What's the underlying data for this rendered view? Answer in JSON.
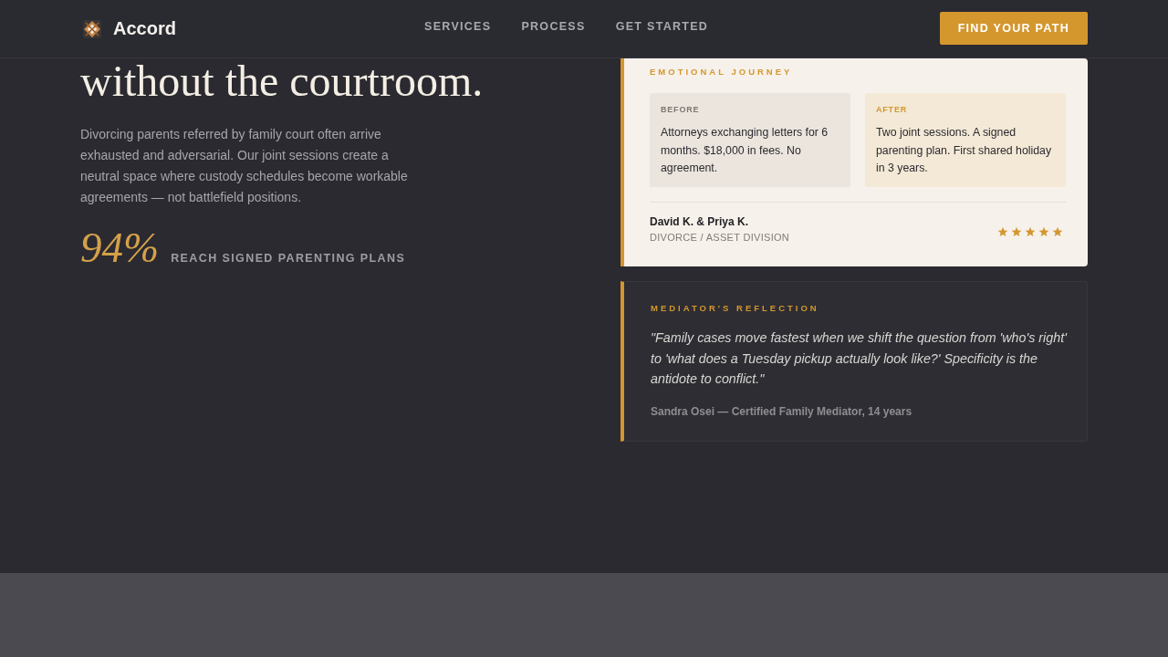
{
  "header": {
    "brand": "Accord",
    "nav": [
      {
        "label": "SERVICES"
      },
      {
        "label": "PROCESS"
      },
      {
        "label": "GET STARTED"
      }
    ],
    "cta": "FIND YOUR PATH"
  },
  "hero": {
    "heading": "without the courtroom.",
    "intro": "Divorcing parents referred by family court often arrive exhausted and adversarial. Our joint sessions create a neutral space where custody schedules become workable agreements — not battlefield positions.",
    "stat": {
      "value": "94%",
      "label": "REACH SIGNED PARENTING PLANS"
    }
  },
  "journey_card": {
    "title": "EMOTIONAL JOURNEY",
    "panels": [
      {
        "kind": "before",
        "label": "BEFORE",
        "text": "Attorneys exchanging letters for 6 months. $18,000 in fees. No agreement."
      },
      {
        "kind": "after",
        "label": "AFTER",
        "text": "Two joint sessions. A signed parenting plan. First shared holiday in 3 years."
      }
    ],
    "client": {
      "name": "David K. & Priya K.",
      "case": "DIVORCE / ASSET DIVISION"
    },
    "stars": 5
  },
  "reflection": {
    "title": "MEDIATOR'S REFLECTION",
    "quote": "\"Family cases move fastest when we shift the question from 'who's right' to 'what does a Tuesday pickup actually look like?' Specificity is the antidote to conflict.\"",
    "attribution": "Sandra Osei — Certified Family Mediator, 14 years"
  }
}
